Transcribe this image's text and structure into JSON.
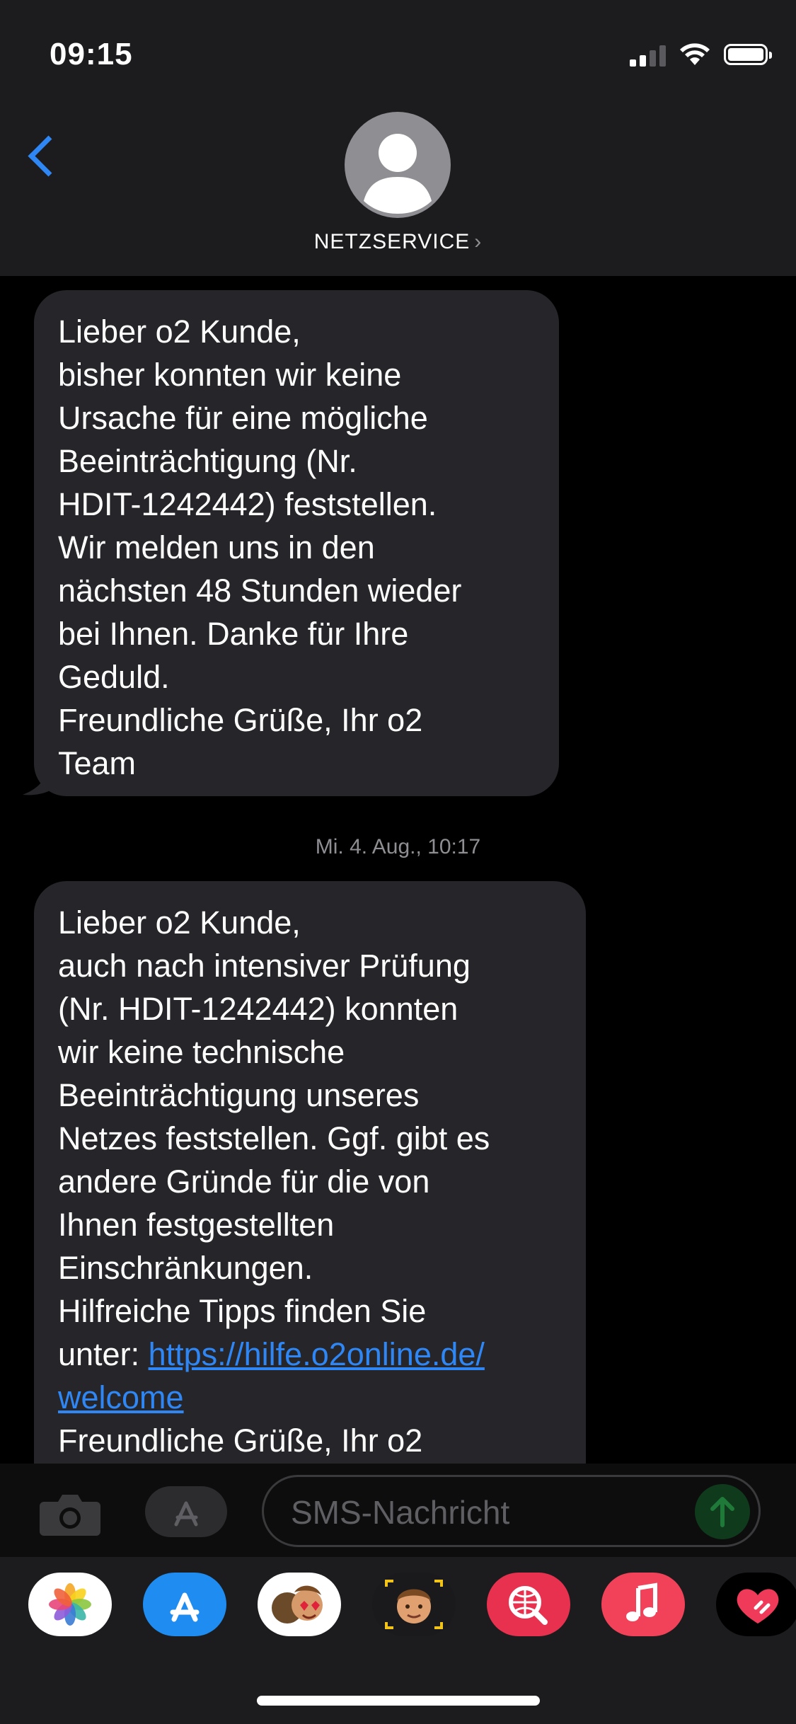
{
  "status_bar": {
    "time": "09:15"
  },
  "header": {
    "contact_name": "NETZSERVICE"
  },
  "messages": [
    {
      "lines": [
        "Lieber o2 Kunde,",
        "bisher konnten wir keine",
        "Ursache für eine mögliche",
        "Beeinträchtigung (Nr.",
        "HDIT-1242442) feststellen.",
        "Wir melden uns in den",
        "nächsten 48 Stunden wieder",
        "bei Ihnen. Danke für Ihre",
        "Geduld.",
        "Freundliche Grüße, Ihr o2",
        "Team"
      ]
    },
    {
      "timestamp": "Mi. 4. Aug., 10:17",
      "lines": [
        "Lieber o2 Kunde,",
        "auch nach intensiver Prüfung",
        "(Nr. HDIT-1242442) konnten",
        "wir keine technische",
        "Beeinträchtigung unseres",
        "Netzes feststellen. Ggf. gibt es",
        "andere Gründe für die von",
        "Ihnen festgestellten",
        "Einschränkungen.",
        "Hilfreiche Tipps finden Sie"
      ],
      "link_prefix": "unter: ",
      "link_part1": "https://hilfe.o2online.de/",
      "link_part2": "welcome",
      "closing": "Freundliche Grüße, Ihr o2"
    }
  ],
  "input": {
    "placeholder": "SMS-Nachricht"
  },
  "app_drawer": [
    "photos-app",
    "app-store-app",
    "memoji-stickers-app",
    "animoji-app",
    "web-search-app",
    "music-app",
    "digital-touch-app"
  ],
  "colors": {
    "accent": "#2f87f5",
    "bubble": "#26262a",
    "header": "#1c1c1e"
  }
}
